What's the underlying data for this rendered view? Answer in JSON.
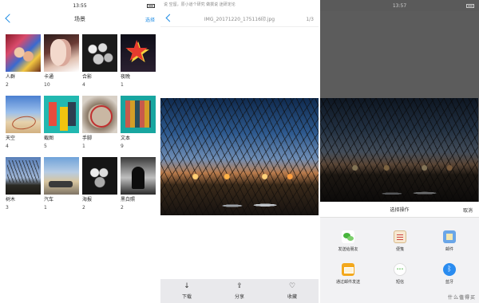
{
  "albums": {
    "status_bar": {
      "time": "13:55",
      "icons": "▢ ◉ ◔ ▮"
    },
    "nav": {
      "title": "场景",
      "action": "选择"
    },
    "items": [
      {
        "label": "人群",
        "count": "2",
        "thumb": "t-people"
      },
      {
        "label": "卡通",
        "count": "10",
        "thumb": "t-cartoon"
      },
      {
        "label": "合影",
        "count": "4",
        "thumb": "t-group"
      },
      {
        "label": "夜晚",
        "count": "1",
        "thumb": "t-night"
      },
      {
        "label": "天空",
        "count": "4",
        "thumb": "t-sky"
      },
      {
        "label": "截图",
        "count": "5",
        "thumb": "t-shot"
      },
      {
        "label": "手脚",
        "count": "1",
        "thumb": "t-hand"
      },
      {
        "label": "文本",
        "count": "9",
        "thumb": "t-text"
      },
      {
        "label": "树木",
        "count": "3",
        "thumb": "t-tree"
      },
      {
        "label": "汽车",
        "count": "1",
        "thumb": "t-car"
      },
      {
        "label": "海报",
        "count": "2",
        "thumb": "t-poster"
      },
      {
        "label": "黑白照",
        "count": "2",
        "thumb": "t-bw"
      }
    ]
  },
  "viewer": {
    "top_text": "说 空留，原小道个研究 做撰说 迷研定论",
    "nav": {
      "title": "IMG_20171220_175116印.jpg",
      "page": "1/3"
    },
    "toolbar": [
      {
        "label": "下载",
        "icon": "↓"
      },
      {
        "label": "分享",
        "icon": "⇪"
      },
      {
        "label": "收藏",
        "icon": "♡"
      }
    ]
  },
  "share": {
    "status_bar": {
      "time": "13:57",
      "icons": "▢ ◉ ◔ ▮"
    },
    "sheet": {
      "title": "选择操作",
      "cancel": "取消"
    },
    "options": [
      {
        "label": "发送给朋友",
        "icon": "wechat"
      },
      {
        "label": "便笺",
        "icon": "note"
      },
      {
        "label": "邮件",
        "icon": "mailapp"
      },
      {
        "label": "通过邮件发送",
        "icon": "email"
      },
      {
        "label": "短信",
        "icon": "sms"
      },
      {
        "label": "蓝牙",
        "icon": "bt"
      }
    ],
    "watermark": "什么值得买"
  }
}
